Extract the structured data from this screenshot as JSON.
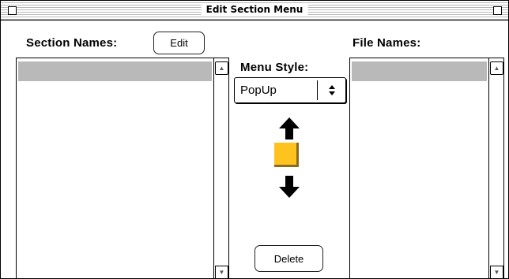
{
  "window": {
    "title": "Edit Section Menu"
  },
  "sections": {
    "label": "Section Names:",
    "edit_label": "Edit"
  },
  "menu_style": {
    "label": "Menu Style:",
    "selected": "PopUp"
  },
  "files": {
    "label": "File Names:"
  },
  "actions": {
    "delete_label": "Delete"
  },
  "colors": {
    "move_handle": "#ffc21f",
    "selection": "#b9b9b9"
  }
}
